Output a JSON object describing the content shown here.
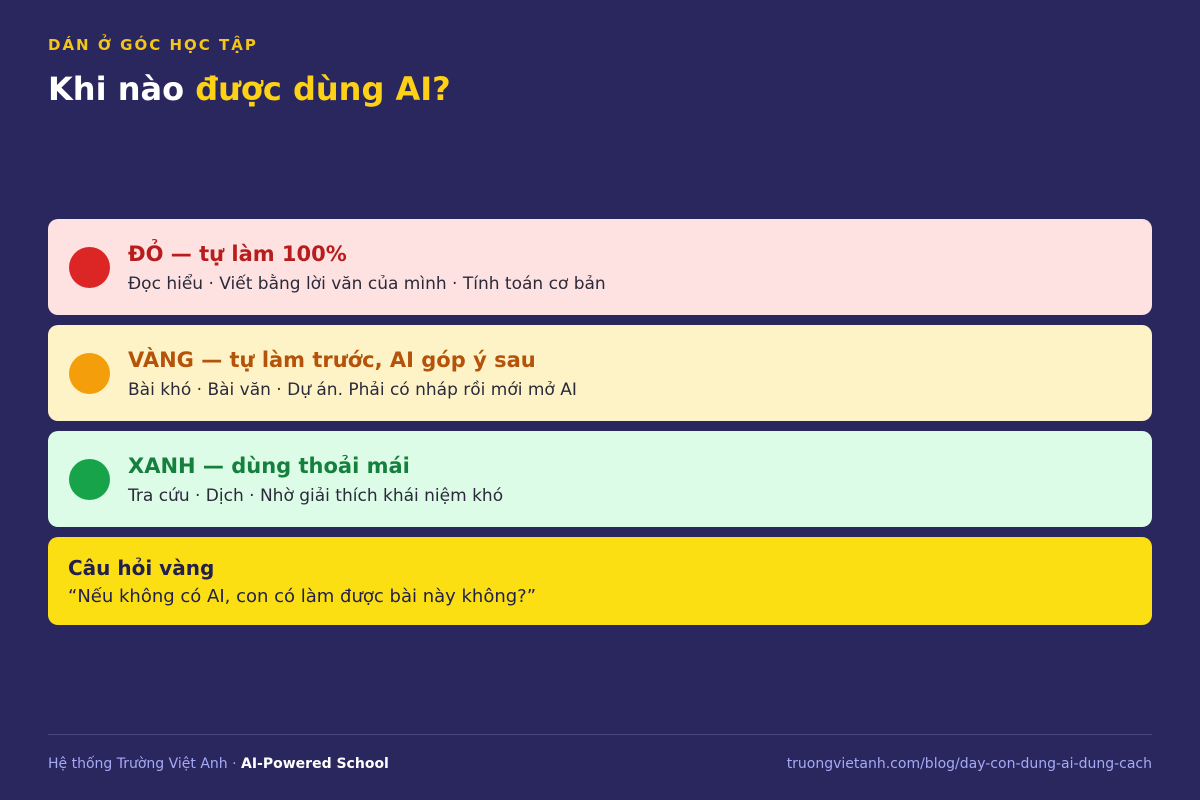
{
  "header": {
    "eyebrow": "DÁN Ở GÓC HỌC TẬP",
    "title_prefix": "Khi nào ",
    "title_highlight": "được dùng AI?"
  },
  "colors": {
    "background": "#29275e",
    "accent": "#fcd116",
    "red": "#dc2626",
    "yellow": "#f59e0b",
    "green": "#16a34a"
  },
  "cards": [
    {
      "icon": "red-circle-icon",
      "title": "ĐỎ — tự làm 100%",
      "description": "Đọc hiểu · Viết bằng lời văn của mình · Tính toán cơ bản"
    },
    {
      "icon": "yellow-circle-icon",
      "title": "VÀNG — tự làm trước, AI góp ý sau",
      "description": "Bài khó · Bài văn · Dự án. Phải có nháp rồi mới mở AI"
    },
    {
      "icon": "green-circle-icon",
      "title": "XANH — dùng thoải mái",
      "description": "Tra cứu · Dịch · Nhờ giải thích khái niệm khó"
    }
  ],
  "golden_question": {
    "title": "Câu hỏi vàng",
    "quote": "“Nếu không có AI, con có làm được bài này không?”"
  },
  "footer": {
    "org": "Hệ thống Trường Việt Anh · ",
    "brand": "AI-Powered School",
    "url": "truongvietanh.com/blog/day-con-dung-ai-dung-cach"
  }
}
